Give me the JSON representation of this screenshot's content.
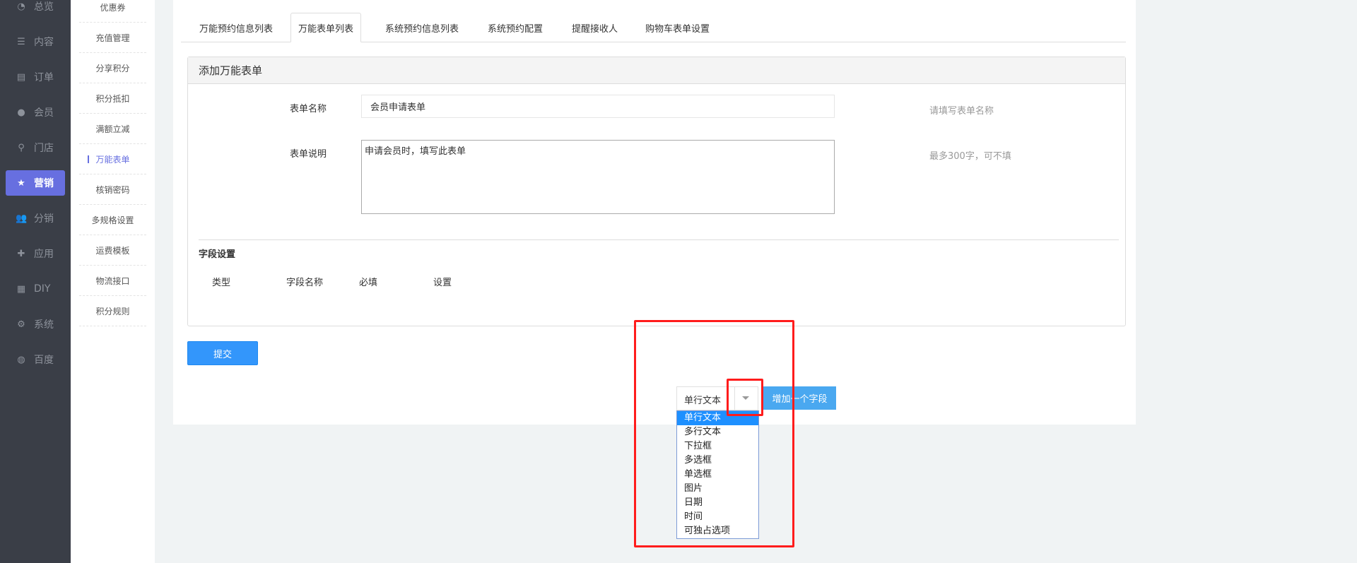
{
  "sidebar": {
    "items": [
      {
        "label": "总览",
        "icon": "pie-chart-icon"
      },
      {
        "label": "内容",
        "icon": "list-icon"
      },
      {
        "label": "订单",
        "icon": "document-icon"
      },
      {
        "label": "会员",
        "icon": "user-icon"
      },
      {
        "label": "门店",
        "icon": "map-pin-icon"
      },
      {
        "label": "营销",
        "icon": "star-icon",
        "active": true
      },
      {
        "label": "分销",
        "icon": "users-icon"
      },
      {
        "label": "应用",
        "icon": "puzzle-icon"
      },
      {
        "label": "DIY",
        "icon": "layout-icon"
      },
      {
        "label": "系统",
        "icon": "gear-icon"
      },
      {
        "label": "百度",
        "icon": "baidu-icon"
      }
    ]
  },
  "submenu": {
    "items": [
      "优惠券",
      "充值管理",
      "分享积分",
      "积分抵扣",
      "满额立减",
      "万能表单",
      "核销密码",
      "多规格设置",
      "运费模板",
      "物流接口",
      "积分规则"
    ],
    "active": "万能表单"
  },
  "tabs": [
    "万能预约信息列表",
    "万能表单列表",
    "系统预约信息列表",
    "系统预约配置",
    "提醒接收人",
    "购物车表单设置"
  ],
  "active_tab": "万能表单列表",
  "panel": {
    "title": "添加万能表单",
    "name_label": "表单名称",
    "name_value": "会员申请表单",
    "name_hint": "请填写表单名称",
    "desc_label": "表单说明",
    "desc_value": "申请会员时，填写此表单",
    "desc_hint": "最多300字，可不填",
    "fields_title": "字段设置",
    "columns": [
      "类型",
      "字段名称",
      "必填",
      "设置"
    ]
  },
  "submit_label": "提交",
  "field_type": {
    "selected": "单行文本",
    "options": [
      "单行文本",
      "多行文本",
      "下拉框",
      "多选框",
      "单选框",
      "图片",
      "日期",
      "时间",
      "可独占选项"
    ]
  },
  "add_field_label": "增加一个字段",
  "colors": {
    "accent": "#676fe0",
    "primary": "#3396fb",
    "annotation": "#ff1c1c"
  }
}
